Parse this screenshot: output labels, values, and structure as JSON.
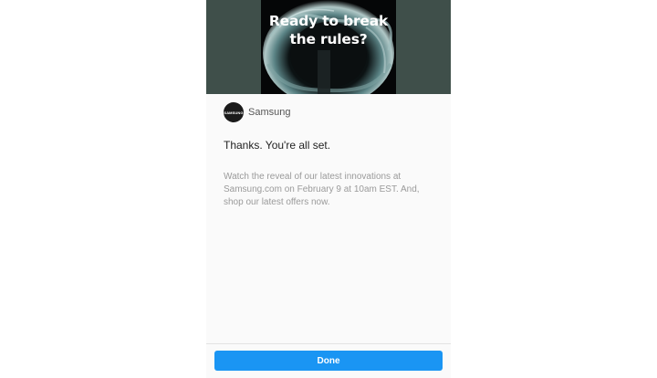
{
  "hero": {
    "line1": "Ready to break",
    "line2": "the rules?",
    "bg_color": "#3f4f4a"
  },
  "advertiser": {
    "logo_text": "SAMSUNG",
    "name": "Samsung"
  },
  "message": {
    "title": "Thanks. You're all set.",
    "body": "Watch the reveal of our latest innovations at Samsung.com on February 9 at 10am EST. And, shop our latest offers now."
  },
  "footer": {
    "done_label": "Done",
    "accent": "#1a95f3"
  }
}
